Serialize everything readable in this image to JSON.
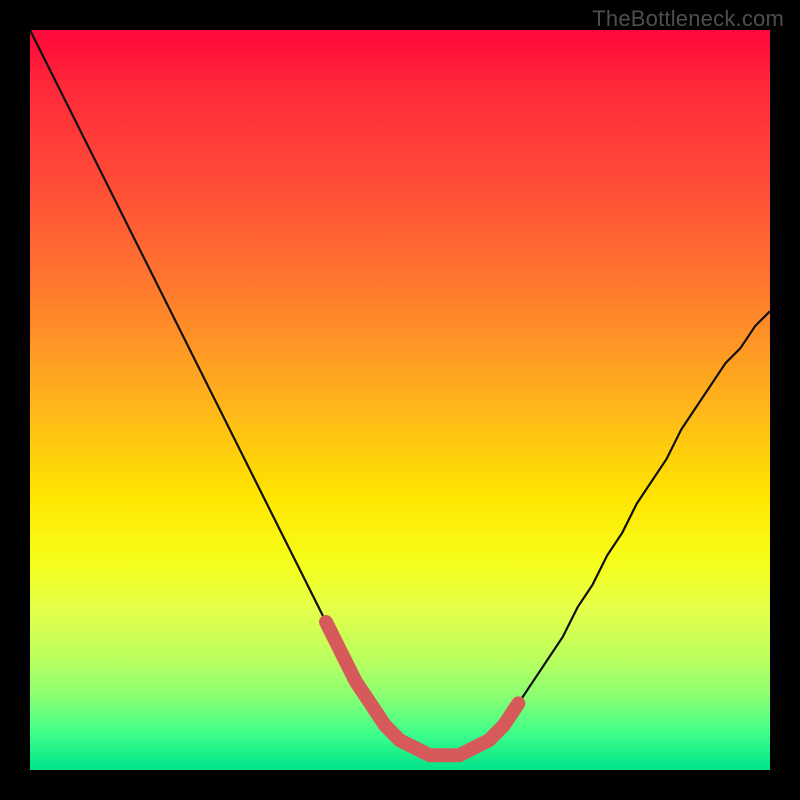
{
  "watermark": "TheBottleneck.com",
  "colors": {
    "frame_bg": "#000000",
    "curve_stroke": "#111111",
    "highlight_stroke": "#d65a5a",
    "watermark_text": "#4e4e4e",
    "gradient_stops": [
      {
        "pos": 0.0,
        "color": "#ff073a"
      },
      {
        "pos": 0.08,
        "color": "#ff2a3a"
      },
      {
        "pos": 0.2,
        "color": "#ff4a38"
      },
      {
        "pos": 0.35,
        "color": "#ff7a2e"
      },
      {
        "pos": 0.5,
        "color": "#ffb21c"
      },
      {
        "pos": 0.63,
        "color": "#ffe500"
      },
      {
        "pos": 0.72,
        "color": "#f6ff1b"
      },
      {
        "pos": 0.78,
        "color": "#e6ff49"
      },
      {
        "pos": 0.85,
        "color": "#baff5e"
      },
      {
        "pos": 0.9,
        "color": "#8aff72"
      },
      {
        "pos": 0.95,
        "color": "#3fff8a"
      },
      {
        "pos": 1.0,
        "color": "#00e38a"
      }
    ]
  },
  "chart_data": {
    "type": "line",
    "title": "",
    "xlabel": "",
    "ylabel": "",
    "xlim": [
      0,
      100
    ],
    "ylim": [
      0,
      100
    ],
    "note": "V-shaped bottleneck curve on a vertical color gradient; y is the percentage bottleneck (0 at the green bottom, 100 at the red top). Values are read off the gradient bands; the valley floor sits at roughly y≈2–3 with a thick pink highlight over the flat region.",
    "series": [
      {
        "name": "bottleneck-curve",
        "x": [
          0,
          2,
          4,
          6,
          8,
          10,
          12,
          14,
          16,
          18,
          20,
          22,
          24,
          26,
          28,
          30,
          32,
          34,
          36,
          38,
          40,
          42,
          44,
          46,
          48,
          50,
          52,
          54,
          56,
          58,
          60,
          62,
          64,
          66,
          68,
          70,
          72,
          74,
          76,
          78,
          80,
          82,
          84,
          86,
          88,
          90,
          92,
          94,
          96,
          98,
          100
        ],
        "y": [
          100,
          96,
          92,
          88,
          84,
          80,
          76,
          72,
          68,
          64,
          60,
          56,
          52,
          48,
          44,
          40,
          36,
          32,
          28,
          24,
          20,
          16,
          12,
          9,
          6,
          4,
          3,
          2,
          2,
          2,
          3,
          4,
          6,
          9,
          12,
          15,
          18,
          22,
          25,
          29,
          32,
          36,
          39,
          42,
          46,
          49,
          52,
          55,
          57,
          60,
          62
        ]
      },
      {
        "name": "highlight-valley",
        "x": [
          40,
          42,
          44,
          46,
          48,
          50,
          52,
          54,
          56,
          58,
          60,
          62,
          64,
          66
        ],
        "y": [
          20,
          16,
          12,
          9,
          6,
          4,
          3,
          2,
          2,
          2,
          3,
          4,
          6,
          9
        ]
      }
    ]
  }
}
